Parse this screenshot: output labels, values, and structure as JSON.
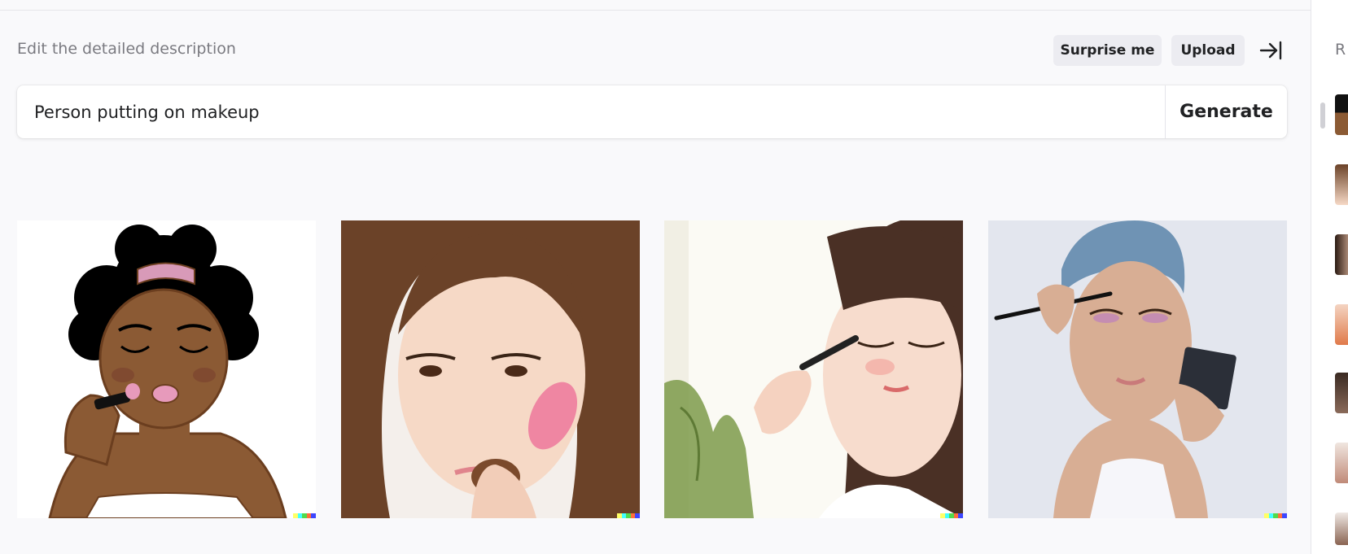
{
  "header": {
    "hint": "Edit the detailed description",
    "surprise_label": "Surprise me",
    "upload_label": "Upload",
    "collapse_icon": "arrow-to-right-icon"
  },
  "prompt": {
    "value": "Person putting on makeup",
    "generate_label": "Generate"
  },
  "results": [
    {
      "description": "cartoon-woman-applying-lipstick"
    },
    {
      "description": "woman-applying-blush-with-brush"
    },
    {
      "description": "woman-applying-eyeliner-near-window"
    },
    {
      "description": "woman-applying-eyeshadow-with-compact-mirror"
    }
  ],
  "signature_colors": [
    "#ffff66",
    "#42ffff",
    "#51da4c",
    "#ff6e3c",
    "#3c46ff"
  ],
  "sidebar": {
    "title": "R",
    "thumbnails": 7
  }
}
